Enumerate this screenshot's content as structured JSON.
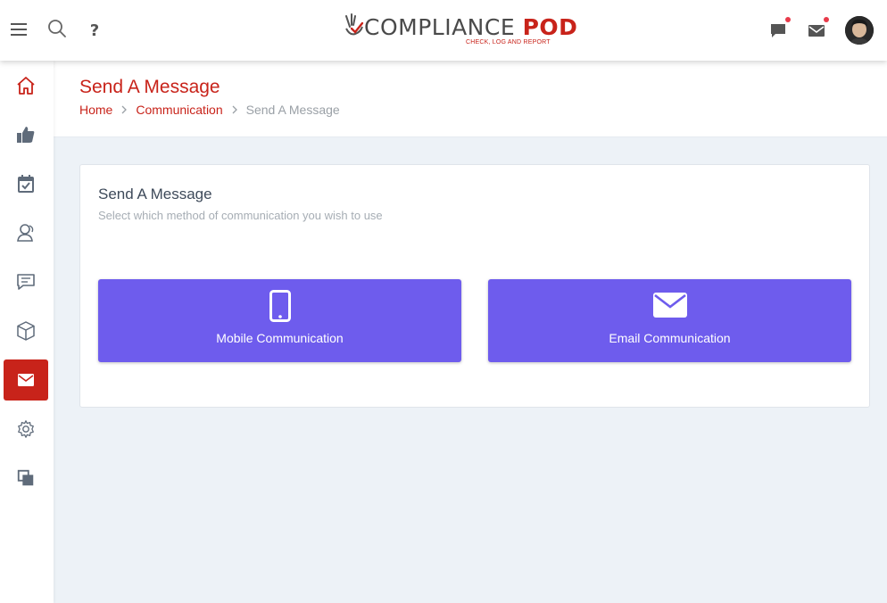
{
  "topbar": {
    "menu_icon": "hamburger-menu-icon",
    "search_icon": "search-icon",
    "help_label": "?",
    "logo": {
      "main_left": "COMPLIANCE ",
      "main_right": "POD",
      "tagline": "CHECK, LOG AND REPORT"
    },
    "chat_icon": "chat-icon",
    "mail_icon": "mail-icon"
  },
  "sidebar": {
    "items": [
      {
        "icon": "home-icon",
        "active": false
      },
      {
        "icon": "thumbs-up-icon",
        "active": false
      },
      {
        "icon": "calendar-check-icon",
        "active": false
      },
      {
        "icon": "users-icon",
        "active": false
      },
      {
        "icon": "message-icon",
        "active": false
      },
      {
        "icon": "box-icon",
        "active": false
      },
      {
        "icon": "mail-icon",
        "active": true
      },
      {
        "icon": "gear-icon",
        "active": false
      },
      {
        "icon": "copy-icon",
        "active": false
      }
    ]
  },
  "header": {
    "title": "Send A Message",
    "breadcrumb": {
      "home": "Home",
      "section": "Communication",
      "current": "Send A Message"
    }
  },
  "card": {
    "title": "Send A Message",
    "subtitle": "Select which method of communication you wish to use",
    "options": [
      {
        "label": "Mobile Communication",
        "icon": "mobile-phone-icon"
      },
      {
        "label": "Email Communication",
        "icon": "envelope-icon"
      }
    ]
  },
  "colors": {
    "accent": "#c8231a",
    "button": "#6e5ced",
    "background": "#edf2f7",
    "notification": "#e83a4a"
  }
}
